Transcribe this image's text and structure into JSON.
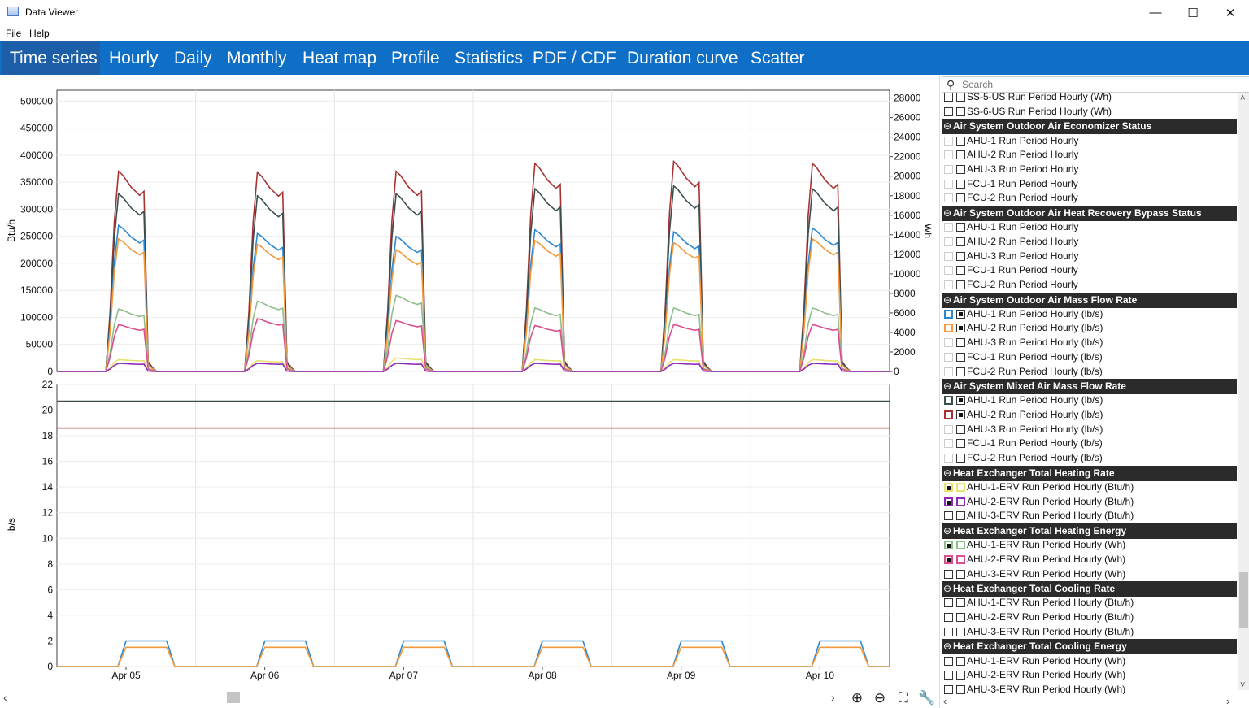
{
  "window": {
    "title": "Data Viewer",
    "minimize": "—",
    "maximize": "☐",
    "close": "✕"
  },
  "menu": [
    "File",
    "Help"
  ],
  "tabs": [
    "Time series",
    "Hourly",
    "Daily",
    "Monthly",
    "Heat map",
    "Profile",
    "Statistics",
    "PDF / CDF",
    "Duration curve",
    "Scatter"
  ],
  "active_tab": "Time series",
  "search": {
    "placeholder": "Search",
    "value": ""
  },
  "toolbar": {
    "zoom_in": "⊕",
    "zoom_out": "⊖",
    "fit": "⛶",
    "settings": "🔧"
  },
  "colors": {
    "ahu1_mixed": "#3a4f4e",
    "ahu2_mixed": "#a83232",
    "ahu1_oa": "#2d86d0",
    "ahu2_oa": "#f39a3c",
    "ahu1_erv_heat_rate": "#e8e070",
    "ahu2_erv_heat_rate": "#8e2ab6",
    "ahu1_erv_heat_energy": "#8fbe8c",
    "ahu2_erv_heat_energy": "#d94f8f"
  },
  "chart_data": [
    {
      "type": "line",
      "title": "",
      "ylabel": "Btu/h",
      "y2label": "Wh",
      "ylim": [
        0,
        520000
      ],
      "y2lim": [
        0,
        28800
      ],
      "yticks": [
        "500000",
        "450000",
        "400000",
        "350000",
        "300000",
        "250000",
        "200000",
        "150000",
        "100000",
        "50000",
        "0"
      ],
      "y2ticks": [
        "28000",
        "26000",
        "24000",
        "22000",
        "20000",
        "18000",
        "16000",
        "14000",
        "12000",
        "10000",
        "8000",
        "6000",
        "4000",
        "2000",
        "0"
      ],
      "x": [
        "Apr 05",
        "Apr 06",
        "Apr 07",
        "Apr 08",
        "Apr 09",
        "Apr 10"
      ],
      "grid": true,
      "series": [
        {
          "name": "AHU-2 Run Period Hourly (lb/s)",
          "axis": "y2",
          "peaks": [
            20500,
            20400,
            20500,
            21300,
            21500,
            21300
          ]
        },
        {
          "name": "AHU-1 Run Period Hourly (lb/s)",
          "axis": "y2",
          "peaks": [
            18200,
            18000,
            18200,
            18700,
            19000,
            18700
          ]
        },
        {
          "name": "AHU-1 Run Period Hourly (lb/s)",
          "axis": "y",
          "peaks": [
            270000,
            255000,
            250000,
            262000,
            258000,
            265000
          ]
        },
        {
          "name": "AHU-2 Run Period Hourly (lb/s)",
          "axis": "y",
          "peaks": [
            245000,
            235000,
            225000,
            242000,
            238000,
            245000
          ]
        },
        {
          "name": "AHU-1-ERV Run Period Hourly (Wh)",
          "axis": "y2",
          "peaks": [
            6400,
            7200,
            7800,
            6500,
            6500,
            6500
          ]
        },
        {
          "name": "AHU-2-ERV Run Period Hourly (Wh)",
          "axis": "y2",
          "peaks": [
            4800,
            5400,
            5200,
            4700,
            4800,
            4800
          ]
        },
        {
          "name": "AHU-1-ERV Run Period Hourly (Btu/h)",
          "axis": "y",
          "peaks": [
            22000,
            20000,
            25000,
            22000,
            22000,
            22000
          ]
        },
        {
          "name": "AHU-2-ERV Run Period Hourly (Btu/h)",
          "axis": "y",
          "peaks": [
            15000,
            15000,
            15000,
            15000,
            15000,
            15000
          ]
        }
      ]
    },
    {
      "type": "line",
      "title": "",
      "ylabel": "lb/s",
      "ylim": [
        0,
        22
      ],
      "yticks": [
        "22",
        "20",
        "18",
        "16",
        "14",
        "12",
        "10",
        "8",
        "6",
        "4",
        "2",
        "0"
      ],
      "x": [
        "Apr 05",
        "Apr 06",
        "Apr 07",
        "Apr 08",
        "Apr 09",
        "Apr 10"
      ],
      "grid": true,
      "series": [
        {
          "name": "AHU-1 Run Period Hourly (lb/s)",
          "constant": 20.7
        },
        {
          "name": "AHU-2 Run Period Hourly (lb/s)",
          "constant": 18.6
        },
        {
          "name": "AHU-1 Run Period Hourly (lb/s)",
          "daily_peak": 2.0
        },
        {
          "name": "AHU-2 Run Period Hourly (lb/s)",
          "daily_peak": 1.5
        }
      ]
    }
  ],
  "sidebar": {
    "rows": [
      {
        "kind": "item",
        "label": "SS-5-US Run Period Hourly (Wh)",
        "a": "plain",
        "b": "plain"
      },
      {
        "kind": "item",
        "label": "SS-6-US Run Period Hourly (Wh)",
        "a": "plain",
        "b": "plain"
      },
      {
        "kind": "group",
        "label": "Air System Outdoor Air Economizer Status"
      },
      {
        "kind": "item",
        "label": "AHU-1 Run Period Hourly",
        "a": "dim",
        "b": "plain"
      },
      {
        "kind": "item",
        "label": "AHU-2 Run Period Hourly",
        "a": "dim",
        "b": "plain"
      },
      {
        "kind": "item",
        "label": "AHU-3 Run Period Hourly",
        "a": "dim",
        "b": "plain"
      },
      {
        "kind": "item",
        "label": "FCU-1 Run Period Hourly",
        "a": "dim",
        "b": "plain"
      },
      {
        "kind": "item",
        "label": "FCU-2 Run Period Hourly",
        "a": "dim",
        "b": "plain"
      },
      {
        "kind": "group",
        "label": "Air System Outdoor Air Heat Recovery Bypass Status"
      },
      {
        "kind": "item",
        "label": "AHU-1 Run Period Hourly",
        "a": "dim",
        "b": "plain"
      },
      {
        "kind": "item",
        "label": "AHU-2 Run Period Hourly",
        "a": "dim",
        "b": "plain"
      },
      {
        "kind": "item",
        "label": "AHU-3 Run Period Hourly",
        "a": "dim",
        "b": "plain"
      },
      {
        "kind": "item",
        "label": "FCU-1 Run Period Hourly",
        "a": "dim",
        "b": "plain"
      },
      {
        "kind": "item",
        "label": "FCU-2 Run Period Hourly",
        "a": "dim",
        "b": "plain"
      },
      {
        "kind": "group",
        "label": "Air System Outdoor Air Mass Flow Rate"
      },
      {
        "kind": "item",
        "label": "AHU-1 Run Period Hourly (lb/s)",
        "a": "color",
        "b": "filled",
        "color": "#2d86d0"
      },
      {
        "kind": "item",
        "label": "AHU-2 Run Period Hourly (lb/s)",
        "a": "color",
        "b": "filled",
        "color": "#f39a3c"
      },
      {
        "kind": "item",
        "label": "AHU-3 Run Period Hourly (lb/s)",
        "a": "dim",
        "b": "plain"
      },
      {
        "kind": "item",
        "label": "FCU-1 Run Period Hourly (lb/s)",
        "a": "dim",
        "b": "plain"
      },
      {
        "kind": "item",
        "label": "FCU-2 Run Period Hourly (lb/s)",
        "a": "dim",
        "b": "plain"
      },
      {
        "kind": "group",
        "label": "Air System Mixed Air Mass Flow Rate"
      },
      {
        "kind": "item",
        "label": "AHU-1 Run Period Hourly (lb/s)",
        "a": "color",
        "b": "filled",
        "color": "#3a4f4e"
      },
      {
        "kind": "item",
        "label": "AHU-2 Run Period Hourly (lb/s)",
        "a": "color",
        "b": "filled",
        "color": "#a83232"
      },
      {
        "kind": "item",
        "label": "AHU-3 Run Period Hourly (lb/s)",
        "a": "dim",
        "b": "plain"
      },
      {
        "kind": "item",
        "label": "FCU-1 Run Period Hourly (lb/s)",
        "a": "dim",
        "b": "plain"
      },
      {
        "kind": "item",
        "label": "FCU-2 Run Period Hourly (lb/s)",
        "a": "dim",
        "b": "plain"
      },
      {
        "kind": "group",
        "label": "Heat Exchanger Total Heating Rate"
      },
      {
        "kind": "item",
        "label": "AHU-1-ERV Run Period Hourly (Btu/h)",
        "a": "filledcolor",
        "b": "color",
        "color": "#e8e070"
      },
      {
        "kind": "item",
        "label": "AHU-2-ERV Run Period Hourly (Btu/h)",
        "a": "filledcolor",
        "b": "color",
        "color": "#8e2ab6"
      },
      {
        "kind": "item",
        "label": "AHU-3-ERV Run Period Hourly (Btu/h)",
        "a": "plain",
        "b": "plain"
      },
      {
        "kind": "group",
        "label": "Heat Exchanger Total Heating Energy"
      },
      {
        "kind": "item",
        "label": "AHU-1-ERV Run Period Hourly (Wh)",
        "a": "filledcolor",
        "b": "color",
        "color": "#8fbe8c"
      },
      {
        "kind": "item",
        "label": "AHU-2-ERV Run Period Hourly (Wh)",
        "a": "filledcolor",
        "b": "color",
        "color": "#d94f8f"
      },
      {
        "kind": "item",
        "label": "AHU-3-ERV Run Period Hourly (Wh)",
        "a": "plain",
        "b": "plain"
      },
      {
        "kind": "group",
        "label": "Heat Exchanger Total Cooling Rate"
      },
      {
        "kind": "item",
        "label": "AHU-1-ERV Run Period Hourly (Btu/h)",
        "a": "plain",
        "b": "plain"
      },
      {
        "kind": "item",
        "label": "AHU-2-ERV Run Period Hourly (Btu/h)",
        "a": "plain",
        "b": "plain"
      },
      {
        "kind": "item",
        "label": "AHU-3-ERV Run Period Hourly (Btu/h)",
        "a": "plain",
        "b": "plain"
      },
      {
        "kind": "group",
        "label": "Heat Exchanger Total Cooling Energy"
      },
      {
        "kind": "item",
        "label": "AHU-1-ERV Run Period Hourly (Wh)",
        "a": "plain",
        "b": "plain"
      },
      {
        "kind": "item",
        "label": "AHU-2-ERV Run Period Hourly (Wh)",
        "a": "plain",
        "b": "plain"
      },
      {
        "kind": "item",
        "label": "AHU-3-ERV Run Period Hourly (Wh)",
        "a": "plain",
        "b": "plain"
      }
    ]
  }
}
